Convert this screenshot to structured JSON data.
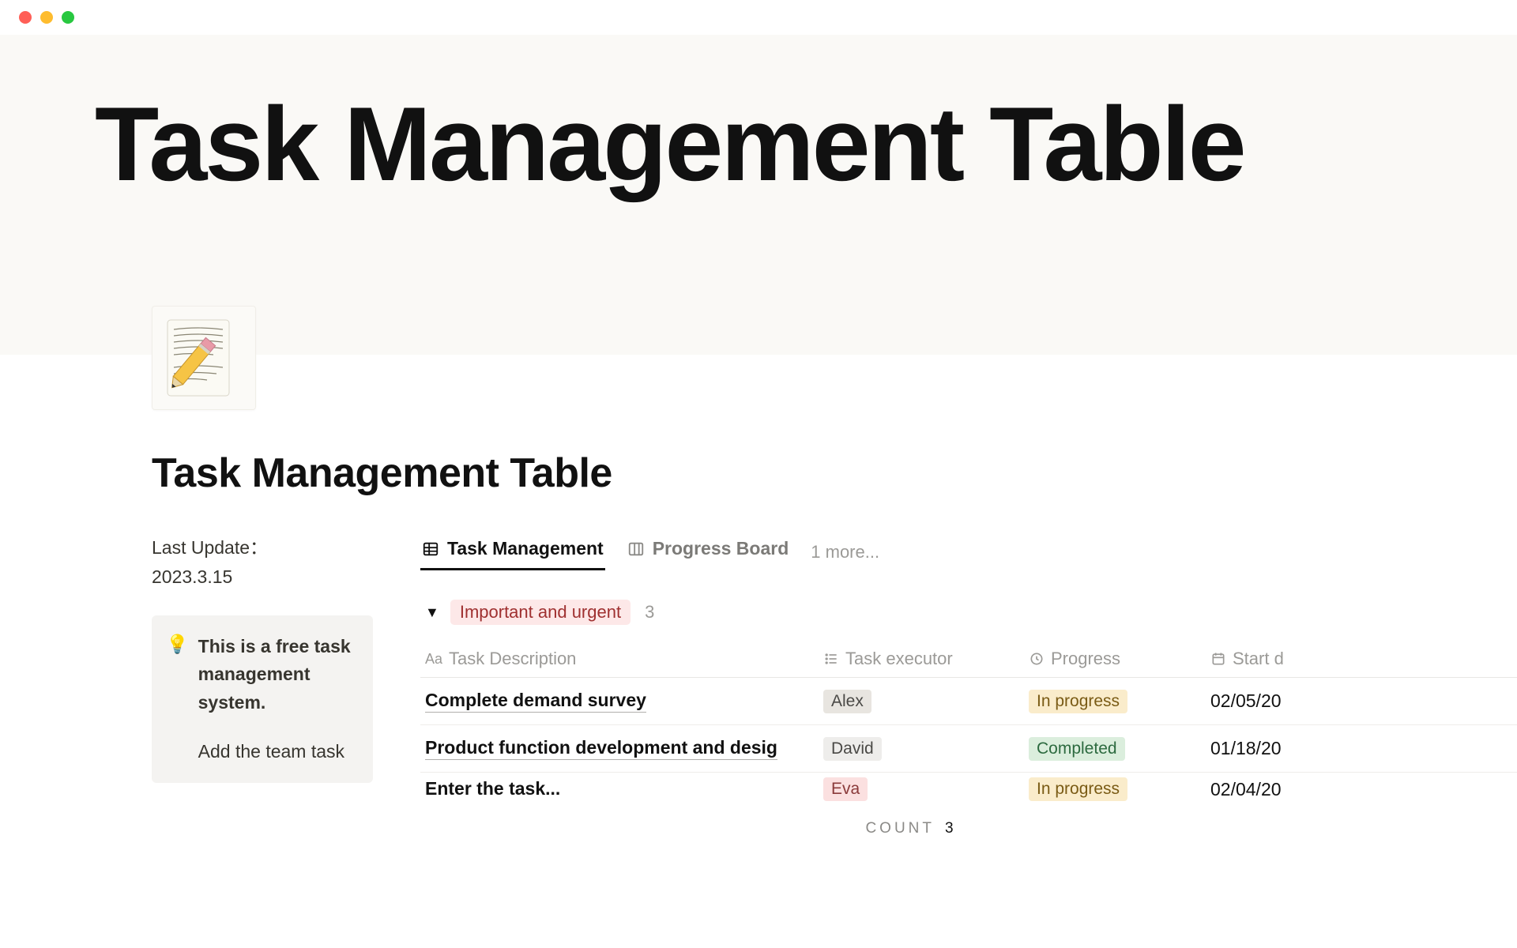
{
  "hero_title": "Task Management Table",
  "page_title": "Task Management Table",
  "last_update_label": "Last Update：",
  "last_update_value": "2023.3.15",
  "callout": {
    "para1": "This is a free task management system.",
    "para2": "Add the team task"
  },
  "tabs": {
    "active": "Task Management",
    "second": "Progress Board",
    "more": "1 more..."
  },
  "group": {
    "label": "Important and urgent",
    "count": "3"
  },
  "columns": {
    "desc": "Task Description",
    "exec": "Task executor",
    "prog": "Progress",
    "date": "Start d"
  },
  "rows": [
    {
      "desc": "Complete demand survey",
      "exec": "Alex",
      "exec_color": "grey",
      "prog": "In progress",
      "prog_color": "yel",
      "date": "02/05/20"
    },
    {
      "desc": "Product function development and desig",
      "exec": "David",
      "exec_color": "lgrey",
      "prog": "Completed",
      "prog_color": "grn",
      "date": "01/18/20"
    },
    {
      "desc": "Enter the task...",
      "exec": "Eva",
      "exec_color": "pink",
      "prog": "In progress",
      "prog_color": "yel",
      "date": "02/04/20"
    }
  ],
  "footer": {
    "label": "COUNT",
    "value": "3"
  }
}
